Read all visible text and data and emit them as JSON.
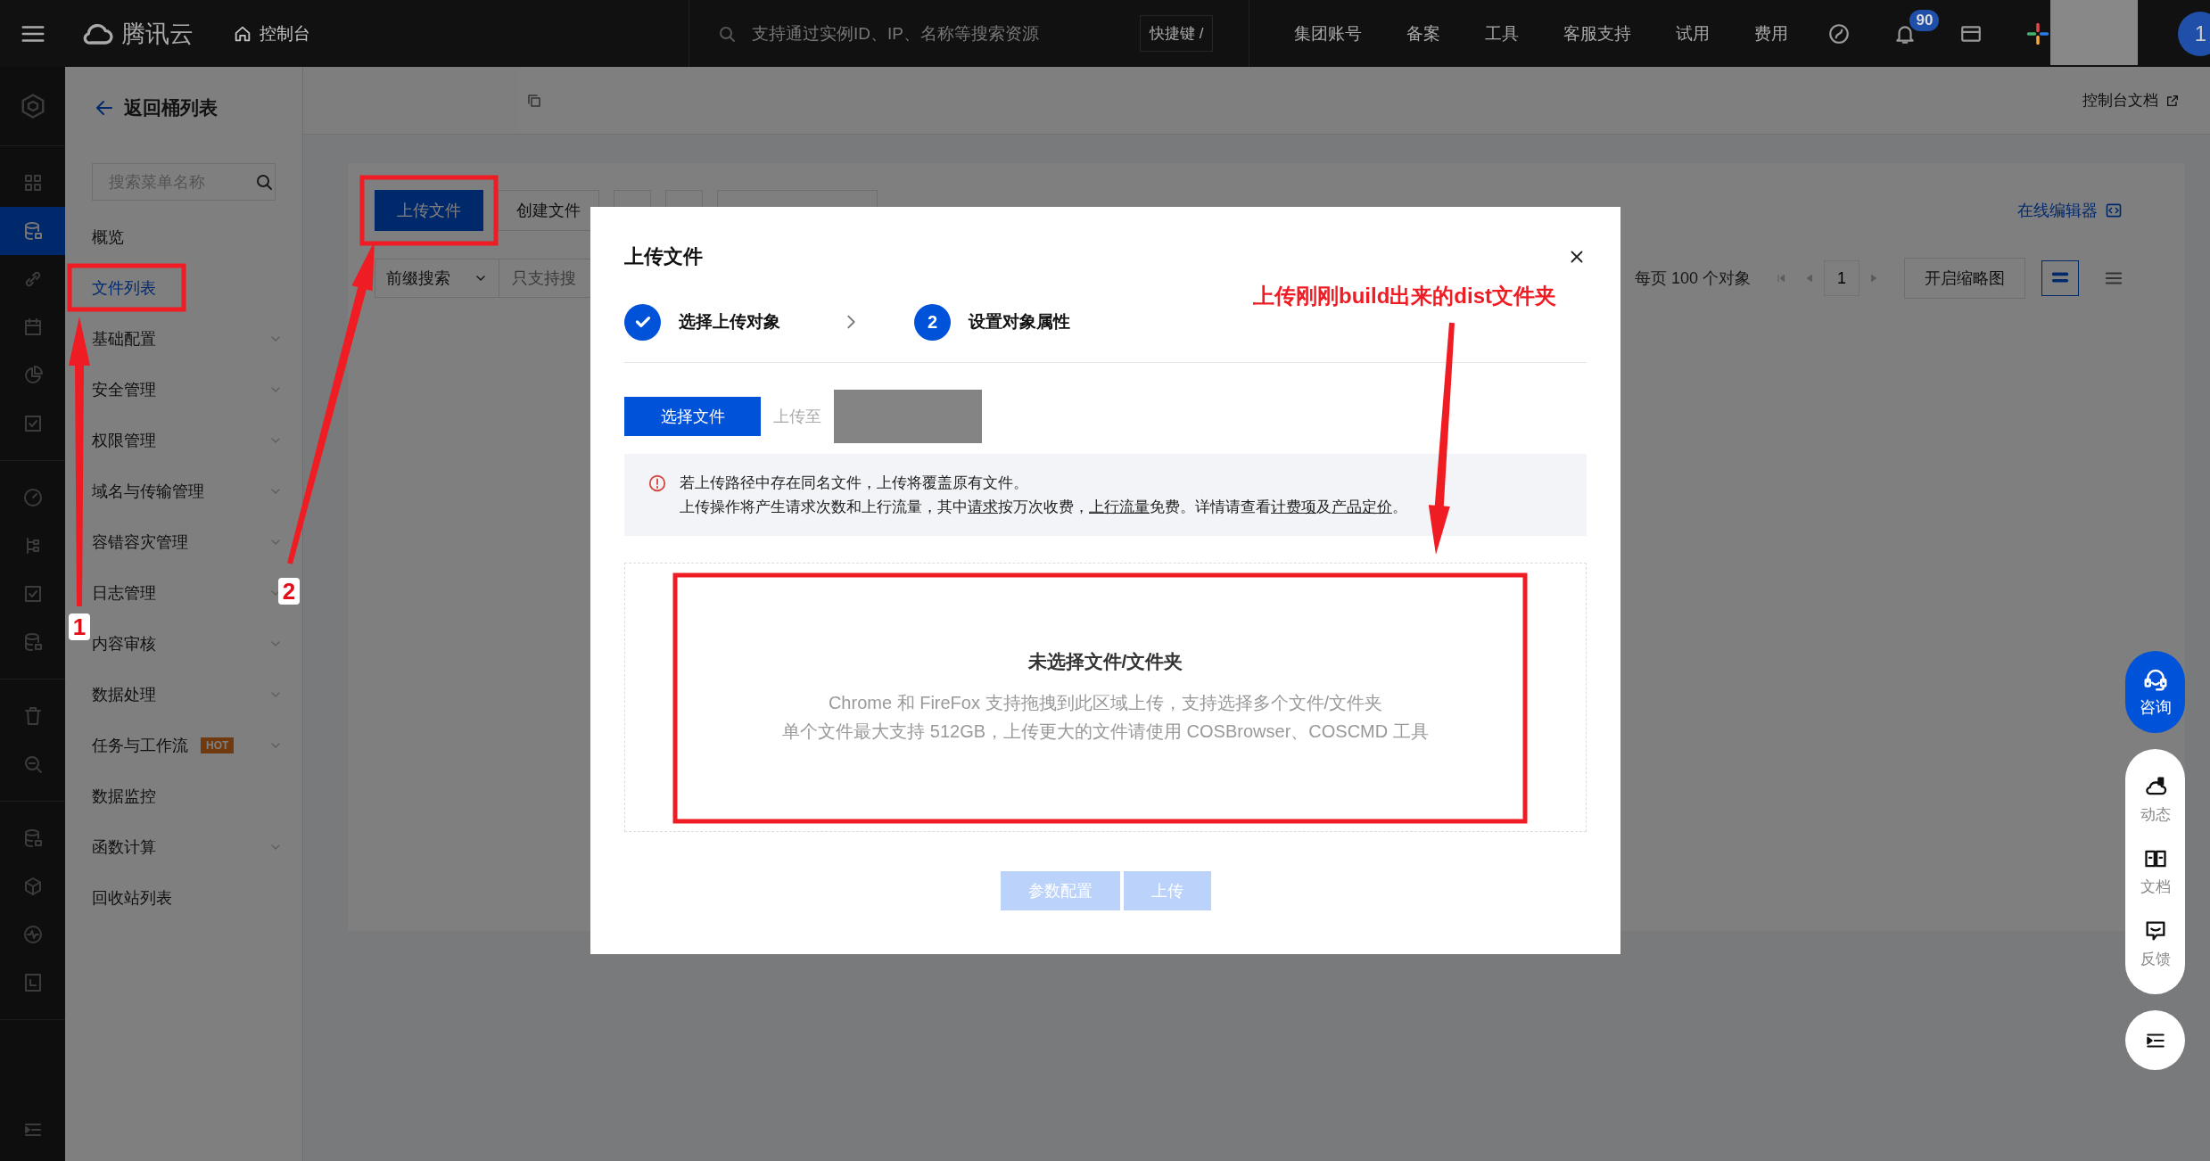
{
  "topbar": {
    "brand": "腾讯云",
    "console": "控制台",
    "search_placeholder": "支持通过实例ID、IP、名称等搜索资源",
    "shortcut": "快捷键 /",
    "nav": [
      "集团账号",
      "备案",
      "工具",
      "客服支持",
      "试用",
      "费用"
    ],
    "notification_count": "90",
    "avatar": "1"
  },
  "rail": {
    "groups": [
      [
        {
          "kind": "grid",
          "selected": false
        },
        {
          "kind": "database",
          "selected": true
        },
        {
          "kind": "link",
          "selected": false
        },
        {
          "kind": "calendar",
          "selected": false
        },
        {
          "kind": "pie",
          "selected": false
        },
        {
          "kind": "checklist",
          "selected": false
        }
      ],
      [
        {
          "kind": "gauge",
          "selected": false
        },
        {
          "kind": "tree",
          "selected": false
        },
        {
          "kind": "checklist",
          "selected": false
        },
        {
          "kind": "database",
          "selected": false
        }
      ],
      [
        {
          "kind": "trash",
          "selected": false
        },
        {
          "kind": "zoom",
          "selected": false
        }
      ],
      [
        {
          "kind": "database",
          "selected": false
        },
        {
          "kind": "cube",
          "selected": false
        },
        {
          "kind": "pulse",
          "selected": false
        },
        {
          "kind": "box",
          "selected": false
        }
      ]
    ]
  },
  "sidebar": {
    "back": "返回桶列表",
    "search_placeholder": "搜索菜单名称",
    "items": [
      {
        "label": "概览",
        "expandable": false,
        "selected": false
      },
      {
        "label": "文件列表",
        "expandable": false,
        "selected": true
      },
      {
        "label": "基础配置",
        "expandable": true,
        "selected": false
      },
      {
        "label": "安全管理",
        "expandable": true,
        "selected": false
      },
      {
        "label": "权限管理",
        "expandable": true,
        "selected": false
      },
      {
        "label": "域名与传输管理",
        "expandable": true,
        "selected": false
      },
      {
        "label": "容错容灾管理",
        "expandable": true,
        "selected": false
      },
      {
        "label": "日志管理",
        "expandable": true,
        "selected": false
      },
      {
        "label": "内容审核",
        "expandable": true,
        "selected": false
      },
      {
        "label": "数据处理",
        "expandable": true,
        "selected": false
      },
      {
        "label": "任务与工作流",
        "expandable": true,
        "selected": false,
        "badge": "HOT"
      },
      {
        "label": "数据监控",
        "expandable": false,
        "selected": false
      },
      {
        "label": "函数计算",
        "expandable": true,
        "selected": false
      },
      {
        "label": "回收站列表",
        "expandable": false,
        "selected": false
      }
    ]
  },
  "header": {
    "docs_link": "控制台文档"
  },
  "toolbar": {
    "buttons": [
      {
        "kind": "primary",
        "label": "上传文件"
      },
      {
        "kind": "default",
        "label": "创建文件"
      },
      {
        "kind": "default"
      },
      {
        "kind": "default"
      },
      {
        "kind": "select"
      }
    ],
    "editor_link": "在线编辑器"
  },
  "filter": {
    "search_type": "前缀搜索",
    "search_placeholder": "只支持搜",
    "page_size": "每页 100 个对象",
    "page": "1",
    "thumbnail_button": "开启缩略图",
    "views": [
      {
        "kind": "grid",
        "selected": true
      },
      {
        "kind": "list",
        "selected": false
      }
    ]
  },
  "modal": {
    "title": "上传文件",
    "steps": [
      {
        "label": "选择上传对象",
        "done": true
      },
      {
        "number": "2",
        "label": "设置对象属性",
        "done": false
      }
    ],
    "select_button": "选择文件",
    "upload_to_label": "上传至",
    "notice": {
      "line1": "若上传路径中存在同名文件，上传将覆盖原有文件。",
      "line2": [
        {
          "text": "上传操作将产生请求次数和上行流量，其中",
          "link": false
        },
        {
          "text": "请求",
          "link": true
        },
        {
          "text": "按万次收费，",
          "link": false
        },
        {
          "text": "上行流量",
          "link": true
        },
        {
          "text": "免费。详情请查看",
          "link": false
        },
        {
          "text": "计费项",
          "link": true
        },
        {
          "text": "及",
          "link": false
        },
        {
          "text": "产品定价",
          "link": true
        },
        {
          "text": "。",
          "link": false
        }
      ]
    },
    "dropzone": {
      "title": "未选择文件/文件夹",
      "lines": [
        "Chrome 和 FireFox 支持拖拽到此区域上传，支持选择多个文件/文件夹",
        "单个文件最大支持 512GB，上传更大的文件请使用 COSBrowser、COSCMD 工具"
      ]
    },
    "footer_buttons": [
      {
        "label": "参数配置",
        "disabled": true
      },
      {
        "label": "上传",
        "disabled": true
      }
    ]
  },
  "float": {
    "consult": "咨询",
    "tools": [
      {
        "kind": "cloud",
        "label": "动态"
      },
      {
        "kind": "book",
        "label": "文档"
      },
      {
        "kind": "feedback",
        "label": "反馈"
      }
    ]
  },
  "annotations": {
    "note": "上传刚刚build出来的dist文件夹",
    "markers": [
      "1",
      "2"
    ]
  }
}
